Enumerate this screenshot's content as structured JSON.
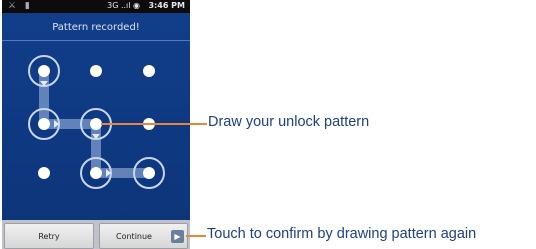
{
  "status_bar": {
    "left_icons": "⚔ ▮",
    "signal": "3G ..ıl ◉",
    "time": "3:46 PM"
  },
  "screen": {
    "title": "Pattern recorded!"
  },
  "buttons": {
    "retry": "Retry",
    "continue": "Continue",
    "continue_arrow": "▶"
  },
  "callouts": {
    "pattern": "Draw your unlock pattern",
    "confirm": "Touch to confirm by drawing pattern again"
  },
  "colors": {
    "callout_text": "#1c3f86",
    "leader_line": "#e8873a",
    "screen_bg": "#0f3a84"
  }
}
